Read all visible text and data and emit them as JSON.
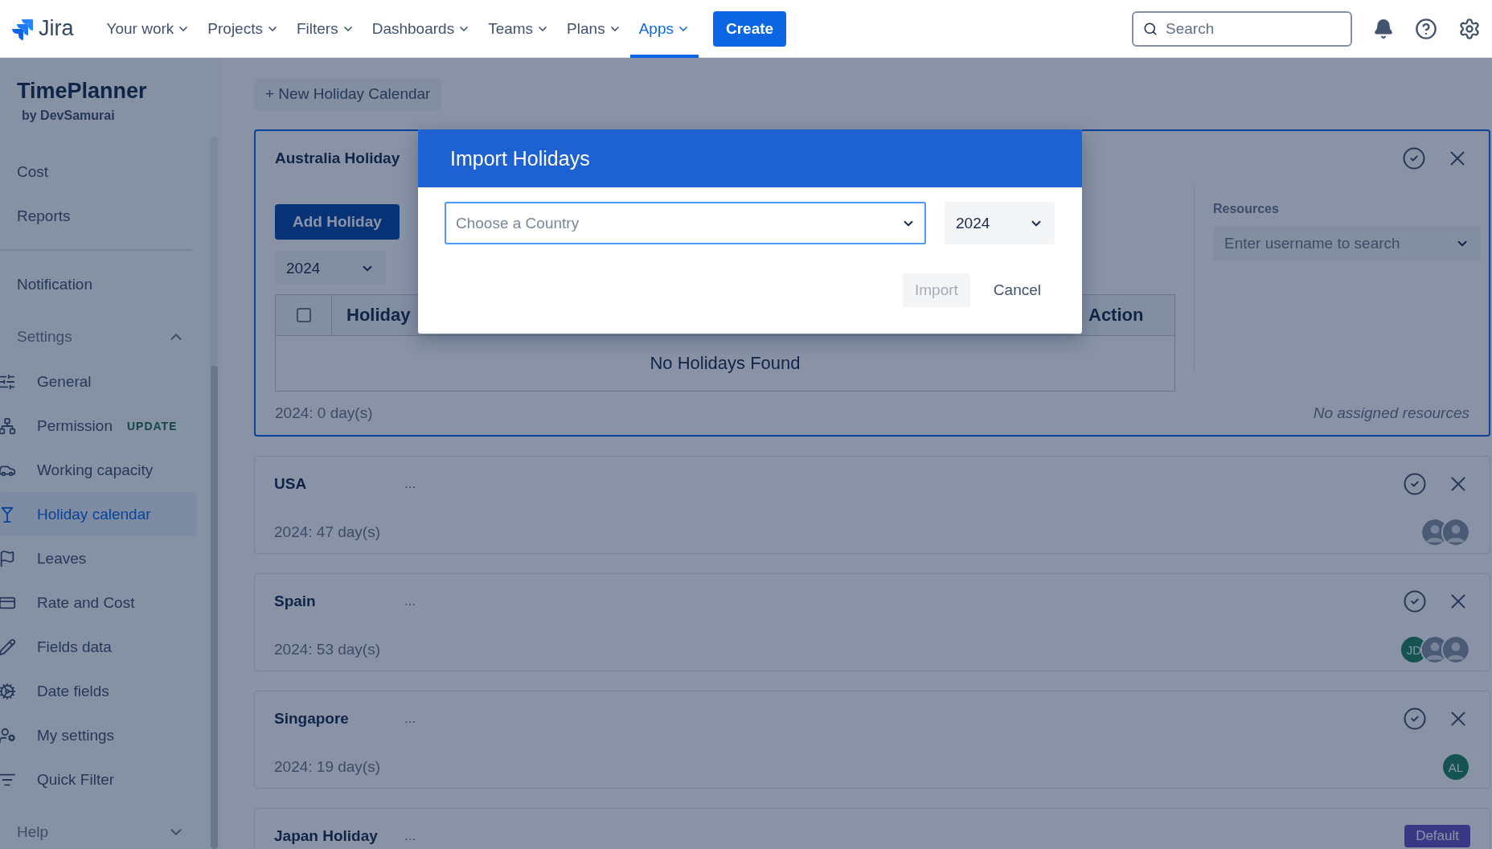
{
  "nav": {
    "logo": "Jira",
    "items": [
      {
        "label": "Your work",
        "selected": false
      },
      {
        "label": "Projects",
        "selected": false
      },
      {
        "label": "Filters",
        "selected": false
      },
      {
        "label": "Dashboards",
        "selected": false
      },
      {
        "label": "Teams",
        "selected": false
      },
      {
        "label": "Plans",
        "selected": false
      },
      {
        "label": "Apps",
        "selected": true
      }
    ],
    "create": "Create",
    "search": {
      "placeholder": "Search"
    }
  },
  "sidebar": {
    "title": "TimePlanner",
    "subtitle": "by DevSamurai",
    "top_items": [
      "Cost",
      "Reports"
    ],
    "notification": "Notification",
    "settings": {
      "label": "Settings",
      "expanded": true,
      "children": [
        {
          "label": "General",
          "selected": false
        },
        {
          "label": "Permission",
          "badge": "UPDATE",
          "selected": false
        },
        {
          "label": "Working capacity",
          "selected": false
        },
        {
          "label": "Holiday calendar",
          "selected": true
        },
        {
          "label": "Leaves",
          "selected": false
        },
        {
          "label": "Rate and Cost",
          "selected": false
        },
        {
          "label": "Fields data",
          "selected": false
        },
        {
          "label": "Date fields",
          "selected": false
        },
        {
          "label": "My settings",
          "selected": false
        },
        {
          "label": "Quick Filter",
          "selected": false
        }
      ]
    },
    "help": {
      "label": "Help",
      "expanded": false
    }
  },
  "new_calendar_button": "+ New Holiday Calendar",
  "calendars": [
    {
      "name": "Australia Holiday",
      "expanded": true,
      "add_button": "Add Holiday",
      "year": "2024",
      "table": {
        "select_all": {
          "checked": false
        },
        "columns": [
          "Holiday",
          "Action"
        ],
        "empty": "No Holidays Found"
      },
      "resources": {
        "label": "Resources",
        "placeholder": "Enter username to search",
        "empty": "No assigned resources"
      },
      "summary": "2024: 0 day(s)"
    },
    {
      "name": "USA",
      "more": "...",
      "expanded": false,
      "summary": "2024: 47 day(s)",
      "avatars": [
        {
          "kind": "photo"
        },
        {
          "kind": "photo"
        }
      ]
    },
    {
      "name": "Spain",
      "more": "...",
      "expanded": false,
      "summary": "2024: 53 day(s)",
      "avatars": [
        {
          "kind": "initials",
          "initials": "JD"
        },
        {
          "kind": "photo"
        },
        {
          "kind": "photo"
        }
      ]
    },
    {
      "name": "Singapore",
      "more": "...",
      "expanded": false,
      "summary": "2024: 19 day(s)",
      "avatars": [
        {
          "kind": "initials",
          "initials": "AL"
        }
      ]
    },
    {
      "name": "Japan Holiday",
      "more": "...",
      "expanded": false,
      "badge": "Default"
    }
  ],
  "modal": {
    "title": "Import Holidays",
    "country": {
      "placeholder": "Choose a Country"
    },
    "year": "2024",
    "import": {
      "label": "Import",
      "disabled": true
    },
    "cancel": "Cancel"
  }
}
